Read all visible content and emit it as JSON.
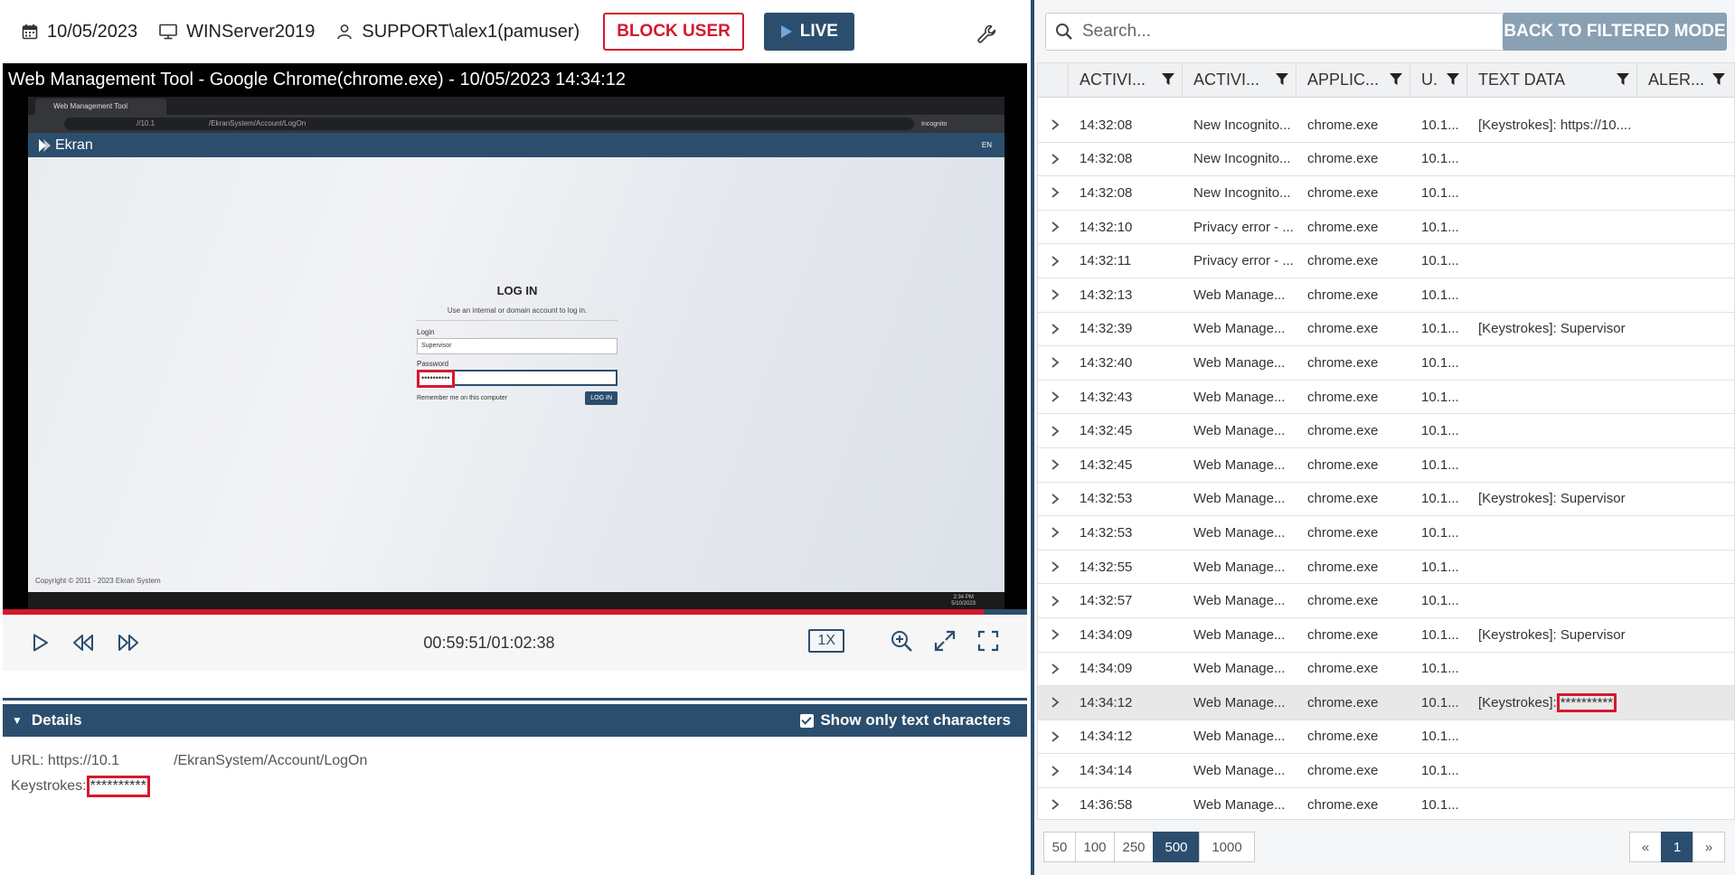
{
  "topbar": {
    "date": "10/05/2023",
    "computer": "WINServer2019",
    "user": "SUPPORT\\alex1(pamuser)",
    "block_label": "BLOCK USER",
    "live_label": "LIVE"
  },
  "player": {
    "window_title": "Web Management Tool - Google Chrome(chrome.exe) - 10/05/2023 14:34:12",
    "screen": {
      "tab_title": "Web Management Tool",
      "address_host": "//10.1",
      "address_path": "/EkranSystem/Account/LogOn",
      "incognito": "Incognito",
      "brand": "Ekran",
      "lang": "EN",
      "login_title": "LOG IN",
      "login_sub": "Use an internal or domain account to log in.",
      "login_label": "Login",
      "login_value": "Supervisor",
      "password_label": "Password",
      "password_value": "••••••••••",
      "remember": "Remember me on this computer",
      "login_btn": "LOG IN",
      "copyright": "Copyright © 2011 - 2023 Ekran System",
      "clock_time": "2:34 PM",
      "clock_date": "5/10/2023"
    },
    "progress": 0.958,
    "timecode": "00:59:51/01:02:38",
    "speed": "1X"
  },
  "details": {
    "title": "Details",
    "show_only": "Show only text characters",
    "url_label": "URL: https://10.1",
    "url_path": "/EkranSystem/Account/LogOn",
    "keystrokes_label": "Keystrokes:",
    "keystrokes_value": "**********"
  },
  "right": {
    "search_placeholder": "Search...",
    "back_label": "BACK TO FILTERED MODE",
    "columns": [
      "ACTIVI...",
      "ACTIVI...",
      "APPLIC...",
      "U.",
      "TEXT DATA",
      "ALER..."
    ],
    "rows": [
      {
        "time": "14:32:08",
        "activity": "New Incognito...",
        "app": "chrome.exe",
        "u": "10.1...",
        "text": "[Keystrokes]: https://10...."
      },
      {
        "time": "14:32:08",
        "activity": "New Incognito...",
        "app": "chrome.exe",
        "u": "10.1...",
        "text": ""
      },
      {
        "time": "14:32:08",
        "activity": "New Incognito...",
        "app": "chrome.exe",
        "u": "10.1...",
        "text": ""
      },
      {
        "time": "14:32:10",
        "activity": "Privacy error - ...",
        "app": "chrome.exe",
        "u": "10.1...",
        "text": ""
      },
      {
        "time": "14:32:11",
        "activity": "Privacy error - ...",
        "app": "chrome.exe",
        "u": "10.1...",
        "text": ""
      },
      {
        "time": "14:32:13",
        "activity": "Web Manage...",
        "app": "chrome.exe",
        "u": "10.1...",
        "text": ""
      },
      {
        "time": "14:32:39",
        "activity": "Web Manage...",
        "app": "chrome.exe",
        "u": "10.1...",
        "text": "[Keystrokes]: Supervisor"
      },
      {
        "time": "14:32:40",
        "activity": "Web Manage...",
        "app": "chrome.exe",
        "u": "10.1...",
        "text": ""
      },
      {
        "time": "14:32:43",
        "activity": "Web Manage...",
        "app": "chrome.exe",
        "u": "10.1...",
        "text": ""
      },
      {
        "time": "14:32:45",
        "activity": "Web Manage...",
        "app": "chrome.exe",
        "u": "10.1...",
        "text": ""
      },
      {
        "time": "14:32:45",
        "activity": "Web Manage...",
        "app": "chrome.exe",
        "u": "10.1...",
        "text": ""
      },
      {
        "time": "14:32:53",
        "activity": "Web Manage...",
        "app": "chrome.exe",
        "u": "10.1...",
        "text": "[Keystrokes]: Supervisor"
      },
      {
        "time": "14:32:53",
        "activity": "Web Manage...",
        "app": "chrome.exe",
        "u": "10.1...",
        "text": ""
      },
      {
        "time": "14:32:55",
        "activity": "Web Manage...",
        "app": "chrome.exe",
        "u": "10.1...",
        "text": ""
      },
      {
        "time": "14:32:57",
        "activity": "Web Manage...",
        "app": "chrome.exe",
        "u": "10.1...",
        "text": ""
      },
      {
        "time": "14:34:09",
        "activity": "Web Manage...",
        "app": "chrome.exe",
        "u": "10.1...",
        "text": "[Keystrokes]: Supervisor"
      },
      {
        "time": "14:34:09",
        "activity": "Web Manage...",
        "app": "chrome.exe",
        "u": "10.1...",
        "text": ""
      },
      {
        "time": "14:34:12",
        "activity": "Web Manage...",
        "app": "chrome.exe",
        "u": "10.1...",
        "text": "[Keystrokes]:",
        "masked": "**********",
        "selected": true
      },
      {
        "time": "14:34:12",
        "activity": "Web Manage...",
        "app": "chrome.exe",
        "u": "10.1...",
        "text": ""
      },
      {
        "time": "14:34:14",
        "activity": "Web Manage...",
        "app": "chrome.exe",
        "u": "10.1...",
        "text": ""
      },
      {
        "time": "14:36:58",
        "activity": "Web Manage...",
        "app": "chrome.exe",
        "u": "10.1...",
        "text": ""
      }
    ],
    "page_sizes": [
      "50",
      "100",
      "250",
      "500",
      "1000"
    ],
    "active_page_size": "500",
    "pages": [
      "«",
      "1",
      "»"
    ],
    "current_page": "1"
  },
  "colors": {
    "brand": "#2c4e6e",
    "alert": "#d5182e",
    "back_button": "#8aa0b3"
  },
  "icons": [
    "calendar-icon",
    "monitor-icon",
    "user-icon",
    "play-icon",
    "wrench-icon",
    "search-icon",
    "filter-icon",
    "chevron-right-icon",
    "rewind-icon",
    "fast-forward-icon",
    "zoom-in-icon",
    "expand-icon",
    "fullscreen-icon"
  ]
}
